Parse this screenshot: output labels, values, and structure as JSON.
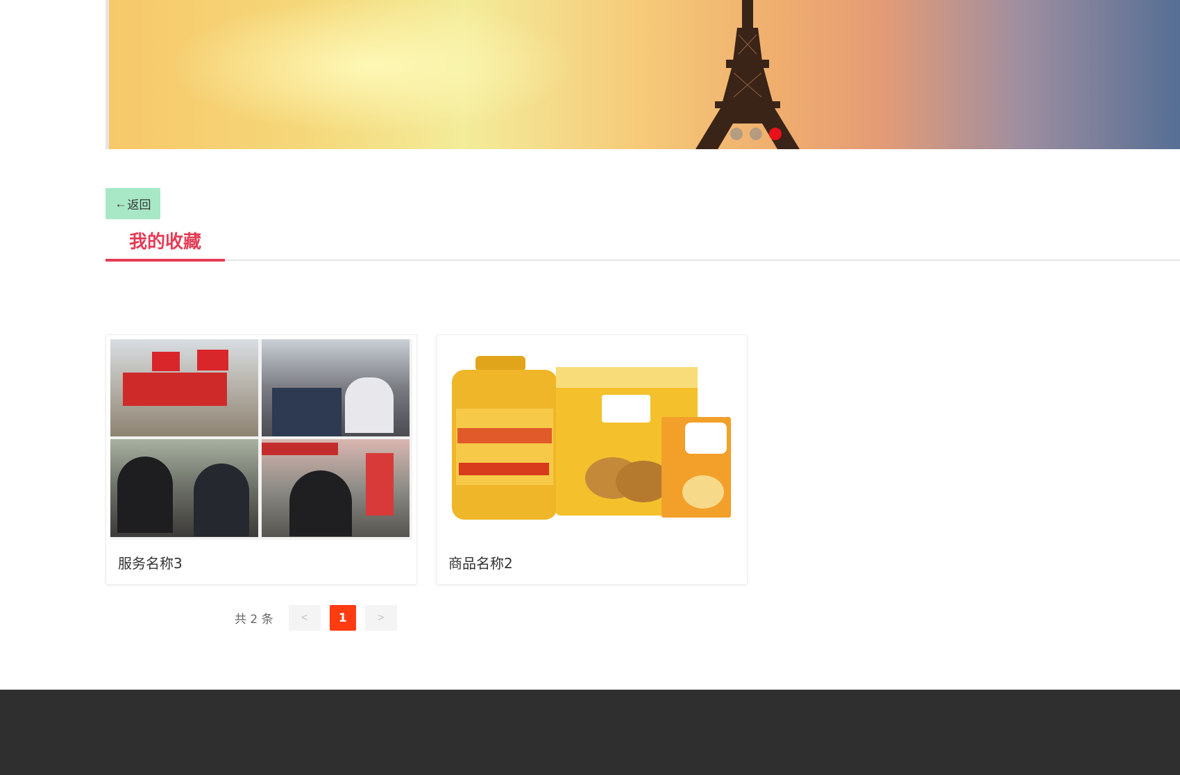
{
  "banner": {
    "slides": 3,
    "active_slide": 3
  },
  "back_button": {
    "arrow": "←",
    "label": "返回"
  },
  "tab": {
    "label": "我的收藏"
  },
  "favorites": [
    {
      "title": "服务名称3",
      "image": "community-service-photo-collage"
    },
    {
      "title": "商品名称2",
      "image": "oil-rice-snacks-product-photo"
    }
  ],
  "pagination": {
    "total_text": "共 2 条",
    "prev": "<",
    "current": "1",
    "next": ">"
  },
  "colors": {
    "accent_red": "#e53c56",
    "page_active": "#ff3b12",
    "back_button_bg": "#a8e8c6",
    "footer_bg": "#2f2f2f"
  }
}
